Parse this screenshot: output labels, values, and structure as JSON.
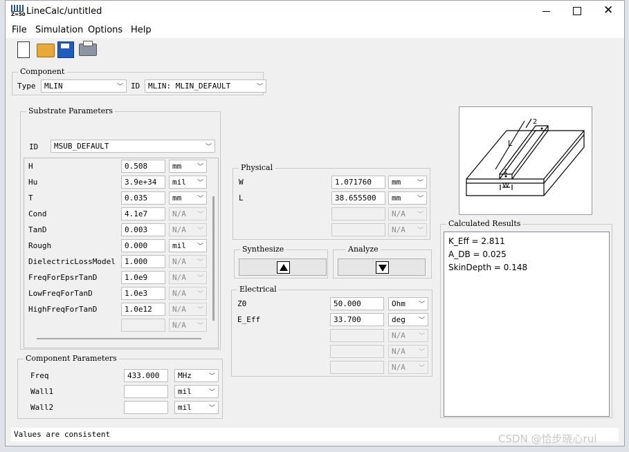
{
  "window": {
    "title": "LineCalc/untitled",
    "app_icon_label": "Z=50"
  },
  "menu": [
    "File",
    "Simulation",
    "Options",
    "Help"
  ],
  "toolbar": {
    "new": "new-file",
    "open": "open-folder",
    "save": "save-disk",
    "print": "printer"
  },
  "component": {
    "group_title": "Component",
    "type_label": "Type",
    "type_value": "MLIN",
    "id_label": "ID",
    "id_value": "MLIN: MLIN_DEFAULT"
  },
  "substrate": {
    "group_title": "Substrate Parameters",
    "id_label": "ID",
    "id_value": "MSUB_DEFAULT",
    "params": [
      {
        "name": "H",
        "value": "0.508",
        "unit": "mm"
      },
      {
        "name": "Hu",
        "value": "3.9e+34",
        "unit": "mil"
      },
      {
        "name": "T",
        "value": "0.035",
        "unit": "mm"
      },
      {
        "name": "Cond",
        "value": "4.1e7",
        "unit": "N/A"
      },
      {
        "name": "TanD",
        "value": "0.003",
        "unit": "N/A"
      },
      {
        "name": "Rough",
        "value": "0.000",
        "unit": "mil"
      },
      {
        "name": "DielectricLossModel",
        "value": "1.000",
        "unit": "N/A"
      },
      {
        "name": "FreqForEpsrTanD",
        "value": "1.0e9",
        "unit": "N/A"
      },
      {
        "name": "LowFreqForTanD",
        "value": "1.0e3",
        "unit": "N/A"
      },
      {
        "name": "HighFreqForTanD",
        "value": "1.0e12",
        "unit": "N/A"
      },
      {
        "name": "",
        "value": "",
        "unit": "N/A"
      }
    ]
  },
  "component_params": {
    "group_title": "Component Parameters",
    "rows": [
      {
        "name": "Freq",
        "value": "433.000",
        "unit": "MHz"
      },
      {
        "name": "Wall1",
        "value": "",
        "unit": "mil"
      },
      {
        "name": "Wall2",
        "value": "",
        "unit": "mil"
      }
    ]
  },
  "physical": {
    "group_title": "Physical",
    "rows": [
      {
        "name": "W",
        "value": "1.071760",
        "unit": "mm"
      },
      {
        "name": "L",
        "value": "38.655500",
        "unit": "mm"
      },
      {
        "name": "",
        "value": "",
        "unit": "N/A"
      },
      {
        "name": "",
        "value": "",
        "unit": "N/A"
      }
    ]
  },
  "synthesize": {
    "group_title": "Synthesize"
  },
  "analyze": {
    "group_title": "Analyze"
  },
  "electrical": {
    "group_title": "Electrical",
    "rows": [
      {
        "name": "Z0",
        "value": "50.000",
        "unit": "Ohm"
      },
      {
        "name": "E_Eff",
        "value": "33.700",
        "unit": "deg"
      },
      {
        "name": "",
        "value": "",
        "unit": "N/A"
      },
      {
        "name": "",
        "value": "",
        "unit": "N/A"
      },
      {
        "name": "",
        "value": "",
        "unit": "N/A"
      }
    ]
  },
  "diagram": {
    "label_L": "L",
    "label_W": "W",
    "port1": "1",
    "port2": "2"
  },
  "results": {
    "group_title": "Calculated Results",
    "lines": [
      "K_Eff = 2.811",
      "A_DB = 0.025",
      "SkinDepth = 0.148"
    ]
  },
  "status": "Values are consistent",
  "watermark": "CSDN @恰步晓心rui"
}
